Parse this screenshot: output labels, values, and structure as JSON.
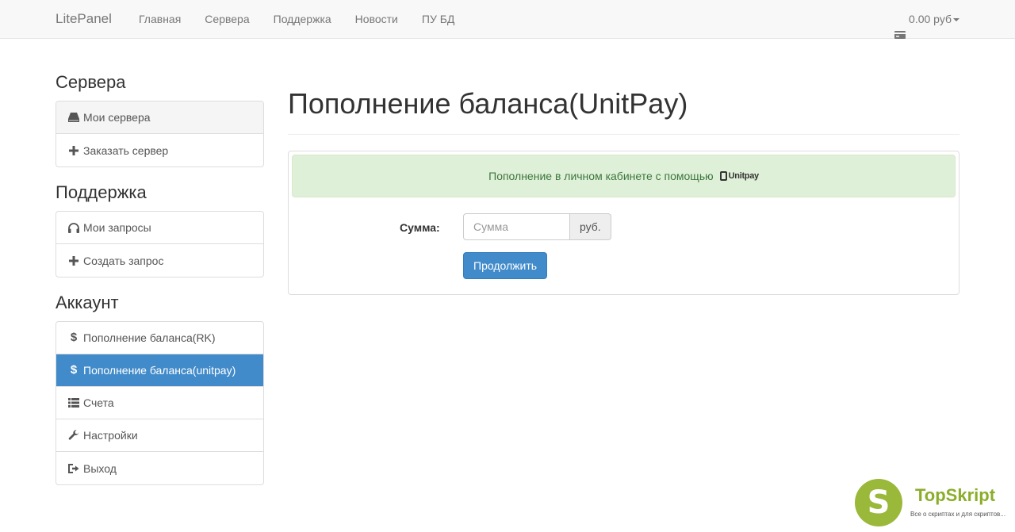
{
  "navbar": {
    "brand": "LitePanel",
    "links": [
      "Главная",
      "Сервера",
      "Поддержка",
      "Новости",
      "ПУ БД"
    ],
    "balance": "0.00 руб"
  },
  "sidebar": {
    "servers": {
      "heading": "Сервера",
      "items": [
        "Мои сервера",
        "Заказать сервер"
      ]
    },
    "support": {
      "heading": "Поддержка",
      "items": [
        "Мои запросы",
        "Создать запрос"
      ]
    },
    "account": {
      "heading": "Аккаунт",
      "items": [
        "Пополнение баланса(RK)",
        "Пополнение баланса(unitpay)",
        "Счета",
        "Настройки",
        "Выход"
      ]
    }
  },
  "main": {
    "title": "Пополнение баланса(UnitPay)",
    "alert_text": "Пополнение в личном кабинете с помощью",
    "alert_logo_text": "Unitpay",
    "sum_label": "Сумма:",
    "sum_placeholder": "Сумма",
    "sum_value": "",
    "currency_addon": "руб.",
    "continue_button": "Продолжить"
  },
  "watermark": {
    "letter": "S",
    "name": "TopSkript",
    "tagline": "Все о скриптах и для скриптов..."
  },
  "colors": {
    "primary": "#428bca",
    "success_bg": "#dff0d8",
    "success_text": "#3c763d",
    "watermark_green": "#9ab83a"
  }
}
